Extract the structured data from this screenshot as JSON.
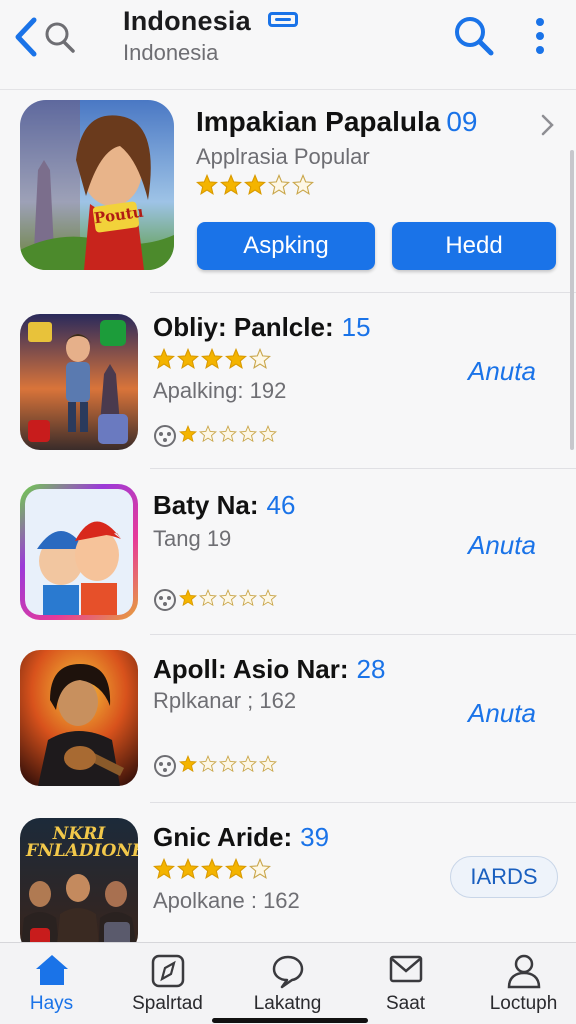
{
  "header": {
    "title": "Indonesia",
    "subtitle": "Indonesia",
    "icons": [
      "back-arrow-icon",
      "search-icon",
      "flag-icon",
      "search-icon",
      "more-vertical-icon"
    ],
    "accent": "#1a73e8"
  },
  "featured": {
    "name": "Impakian Papalula",
    "number": "09",
    "category": "Applrasia Popular",
    "rating": 3,
    "rating_max": 5,
    "primary_button": "Aspking",
    "secondary_button": "Hedd",
    "icon_badge_text": "Poutu"
  },
  "apps": [
    {
      "title": "Obliy: Panlcle:",
      "number": "15",
      "rating": 4,
      "subtitle": "Apalking: 192",
      "small_rating": 1,
      "action": "Anuta",
      "action_style": "link"
    },
    {
      "title": "Baty Na:",
      "number": "46",
      "subtitle": "Tang 19",
      "small_rating": 1,
      "action": "Anuta",
      "action_style": "link"
    },
    {
      "title": "Apoll: Asio Nar:",
      "number": "28",
      "subtitle": "Rplkanar ; 162",
      "small_rating": 1,
      "action": "Anuta",
      "action_style": "link"
    },
    {
      "title": "Gnic Aride:",
      "number": "39",
      "rating": 4,
      "subtitle": "Apolkane : 162",
      "action": "IARDS",
      "action_style": "pill",
      "icon_text": "NKRI FNLADIONE"
    }
  ],
  "tabs": [
    {
      "label": "Hays",
      "icon": "home-icon",
      "active": true
    },
    {
      "label": "Spalrtad",
      "icon": "compass-icon",
      "active": false
    },
    {
      "label": "Lakatng",
      "icon": "chat-bubble-icon",
      "active": false
    },
    {
      "label": "Saat",
      "icon": "mail-icon",
      "active": false
    },
    {
      "label": "Loctuph",
      "icon": "person-icon",
      "active": false
    }
  ],
  "colors": {
    "accent": "#1a73e8",
    "star": "#f4b400",
    "text_secondary": "#6e6e73"
  }
}
